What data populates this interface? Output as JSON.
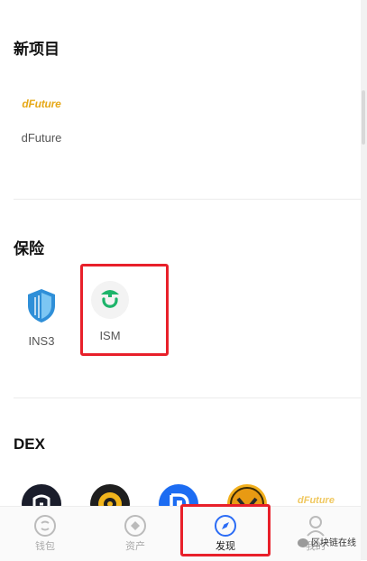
{
  "sections": {
    "new_projects": {
      "title": "新项目",
      "apps": [
        {
          "name": "dFuture",
          "logo_text": "dFuture"
        }
      ]
    },
    "insurance": {
      "title": "保险",
      "apps": [
        {
          "name": "INS3"
        },
        {
          "name": "ISM"
        }
      ]
    },
    "dex": {
      "title": "DEX",
      "apps": [
        {
          "icon": "dex-app-1-icon"
        },
        {
          "icon": "dex-app-2-icon"
        },
        {
          "icon": "dex-app-3-icon"
        },
        {
          "icon": "dex-app-4-icon"
        },
        {
          "icon": "dex-app-5-icon",
          "logo_text": "dFuture"
        }
      ]
    }
  },
  "tabbar": {
    "tabs": [
      {
        "label": "钱包",
        "icon": "wallet-icon",
        "active": false
      },
      {
        "label": "资产",
        "icon": "assets-icon",
        "active": false
      },
      {
        "label": "发现",
        "icon": "compass-icon",
        "active": true
      },
      {
        "label": "我的",
        "icon": "profile-icon",
        "active": false
      }
    ]
  },
  "watermark": "区块链在线",
  "colors": {
    "highlight": "#e8202a",
    "ism_green": "#1db46a",
    "ins3_blue": "#2f8fd8",
    "active_tab": "#2b6cf5"
  }
}
